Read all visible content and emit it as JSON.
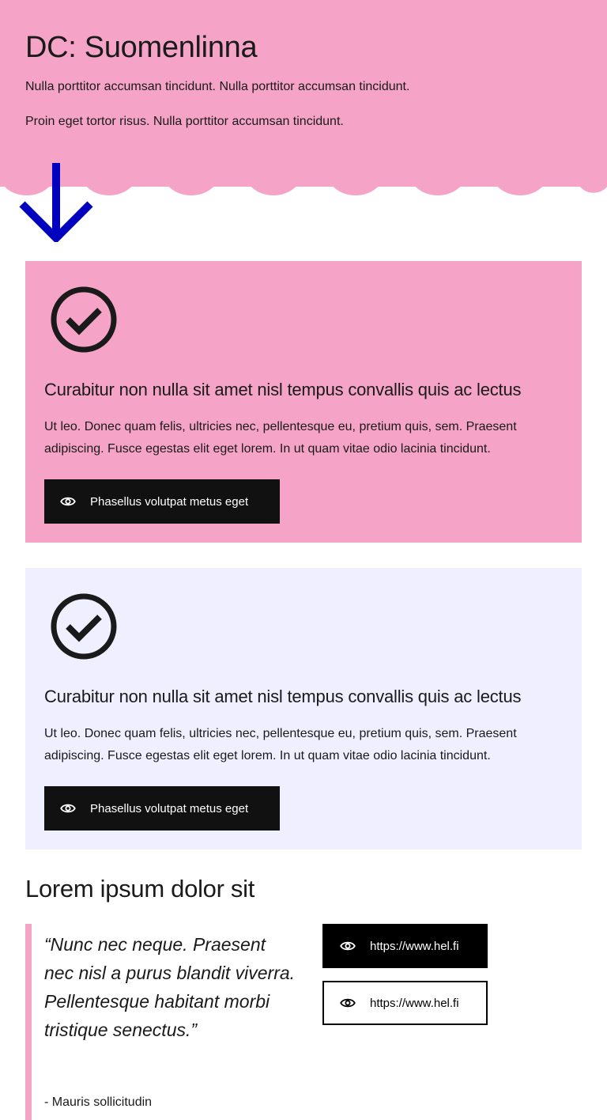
{
  "hero": {
    "title": "DC: Suomenlinna",
    "paragraphs": [
      "Nulla porttitor accumsan tincidunt. Nulla porttitor accumsan tincidunt.",
      "Proin eget tortor risus. Nulla porttitor accumsan tincidunt."
    ],
    "background_color": "#f5a3c7",
    "arrow_icon": "arrow-down-icon",
    "arrow_color": "#0000bf"
  },
  "cards": [
    {
      "icon": "check-circle-icon",
      "heading": "Curabitur non nulla sit amet nisl tempus convallis quis ac lectus",
      "text": "Ut leo. Donec quam felis, ultricies nec, pellentesque eu, pretium quis, sem. Praesent adipiscing. Fusce egestas elit eget lorem. In ut quam vitae odio lacinia tincidunt.",
      "button_label": "Phasellus volutpat metus eget",
      "button_icon": "eye-icon",
      "background_color": "#f5a3c7"
    },
    {
      "icon": "check-circle-icon",
      "heading": "Curabitur non nulla sit amet nisl tempus convallis quis ac lectus",
      "text": "Ut leo. Donec quam felis, ultricies nec, pellentesque eu, pretium quis, sem. Praesent adipiscing. Fusce egestas elit eget lorem. In ut quam vitae odio lacinia tincidunt.",
      "button_label": "Phasellus volutpat metus eget",
      "button_icon": "eye-icon",
      "background_color": "#efefff"
    }
  ],
  "section": {
    "heading": "Lorem ipsum dolor sit",
    "quote": {
      "text": "“Nunc nec neque. Praesent nec nisl a purus blandit viverra. Pellentesque habitant morbi tristique senectus.”",
      "author": "- Mauris sollicitudin",
      "accent_color": "#f5a3c7"
    },
    "links": [
      {
        "label": "https://www.hel.fi",
        "icon": "eye-icon",
        "style": "filled"
      },
      {
        "label": "https://www.hel.fi",
        "icon": "eye-icon",
        "style": "outlined"
      }
    ]
  }
}
